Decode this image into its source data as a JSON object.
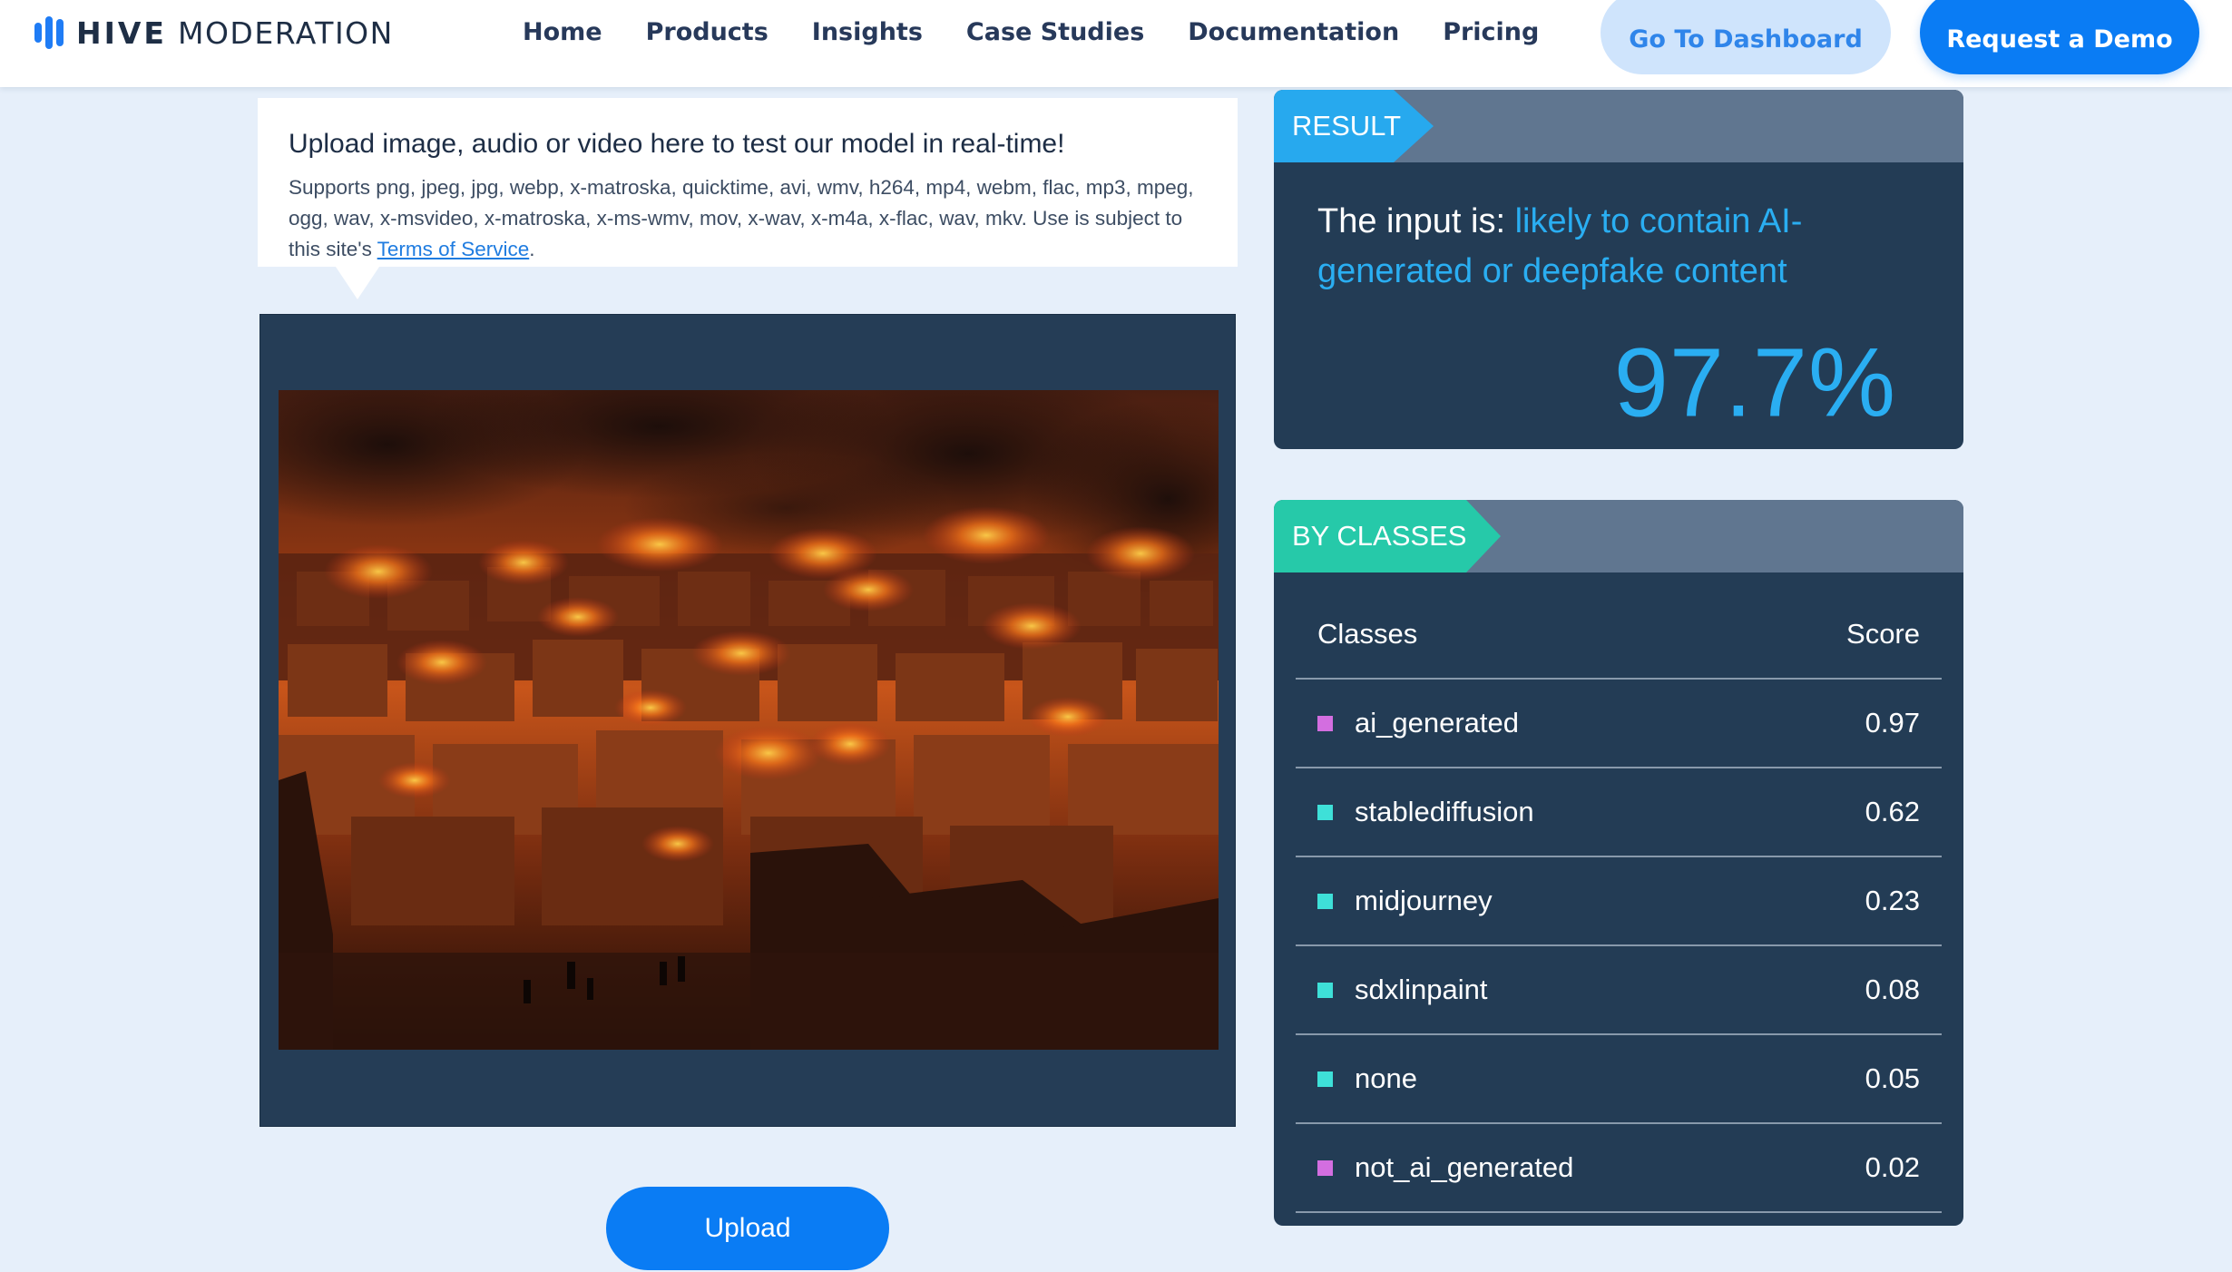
{
  "brand": {
    "name_bold": "HIVE",
    "name_light": "MODERATION",
    "accent_color": "#0a7cf4"
  },
  "nav": {
    "links": [
      "Home",
      "Products",
      "Insights",
      "Case Studies",
      "Documentation",
      "Pricing"
    ],
    "dashboard_label": "Go To Dashboard",
    "demo_label": "Request a Demo"
  },
  "upload_info": {
    "title": "Upload image, audio or video here to test our model in real-time!",
    "description": "Supports png, jpeg, jpg, webp, x-matroska, quicktime, avi, wmv, h264, mp4, webm, flac, mp3, mpeg, ogg, wav, x-msvideo, x-matroska, x-ms-wmv, mov, x-wav, x-m4a, x-flac, wav, mkv. Use is subject to this site's ",
    "tos_link": "Terms of Service",
    "tos_suffix": "."
  },
  "image_panel": {
    "image_icon": "uploaded-image-burning-city"
  },
  "upload_button": "Upload",
  "result": {
    "tag": "RESULT",
    "prefix": "The input is: ",
    "verdict": "likely to contain AI-generated or deepfake content",
    "percent": "97.7%",
    "verdict_color": "#2aaef2"
  },
  "classes": {
    "tag": "BY CLASSES",
    "header_class": "Classes",
    "header_score": "Score",
    "rows": [
      {
        "name": "ai_generated",
        "score": "0.97",
        "color": "#d36ee0"
      },
      {
        "name": "stablediffusion",
        "score": "0.62",
        "color": "#3ee0d8"
      },
      {
        "name": "midjourney",
        "score": "0.23",
        "color": "#3ee0d8"
      },
      {
        "name": "sdxlinpaint",
        "score": "0.08",
        "color": "#3ee0d8"
      },
      {
        "name": "none",
        "score": "0.05",
        "color": "#3ee0d8"
      },
      {
        "name": "not_ai_generated",
        "score": "0.02",
        "color": "#d36ee0"
      }
    ]
  }
}
